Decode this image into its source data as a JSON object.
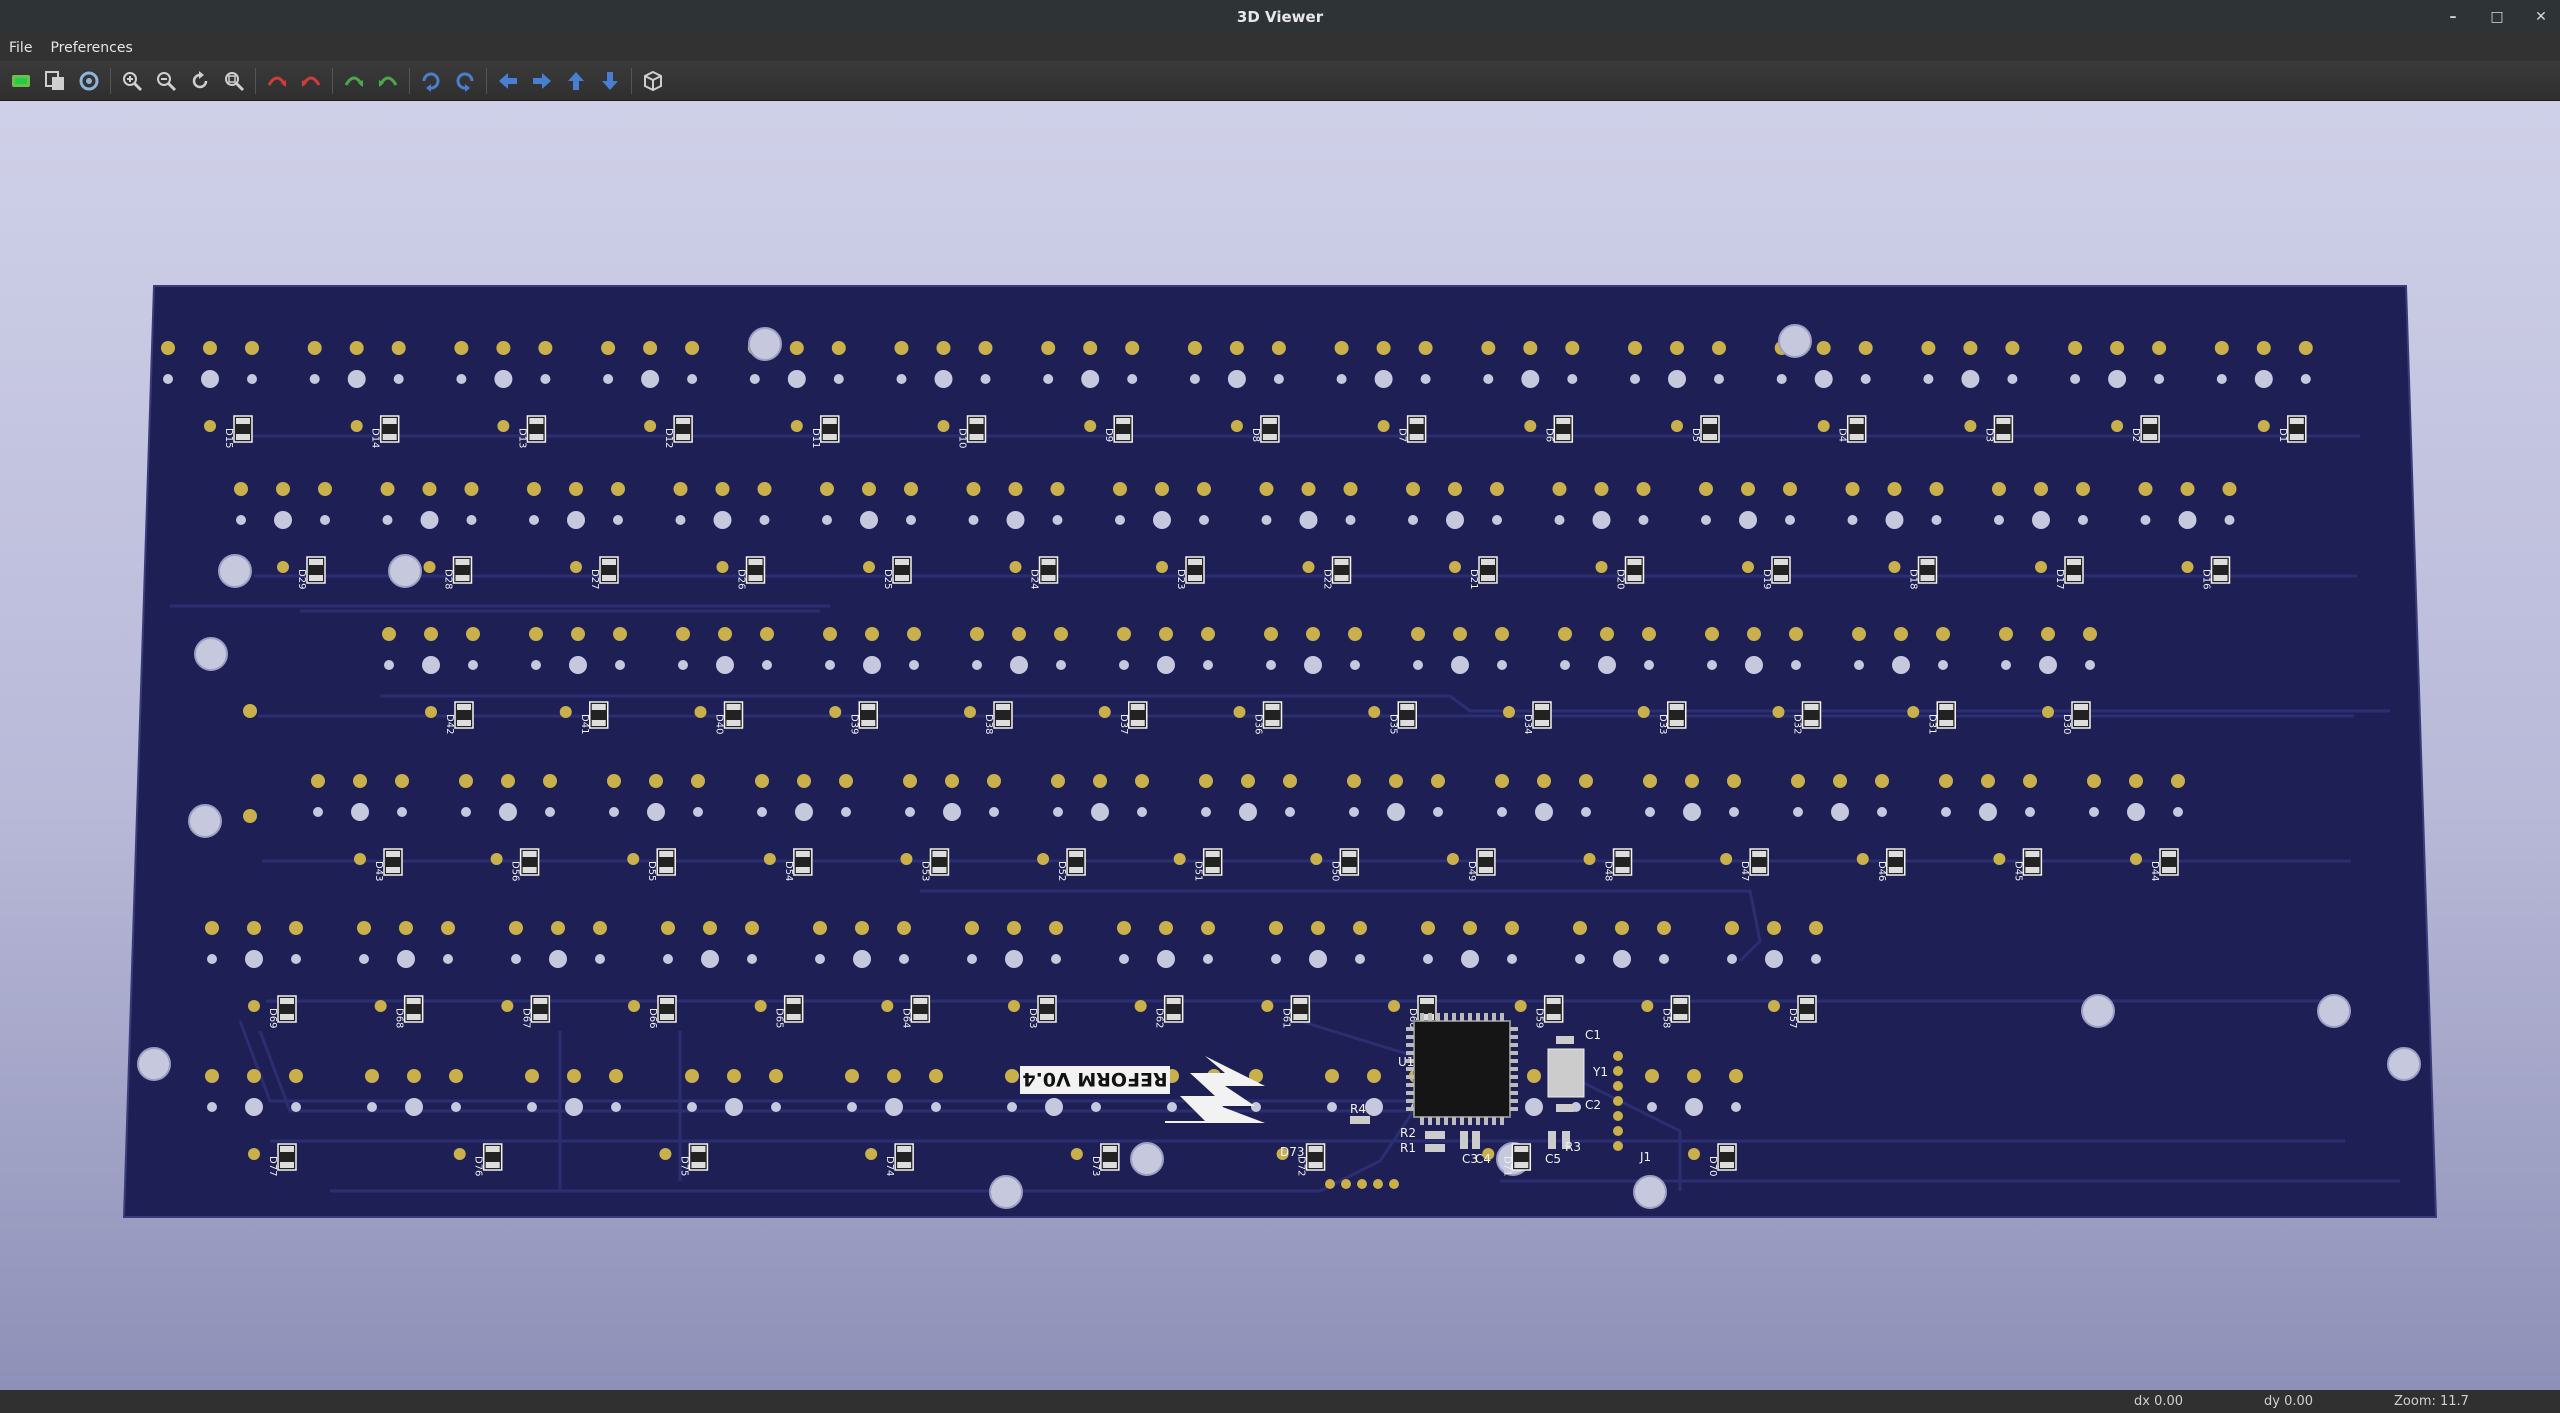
{
  "window": {
    "title": "3D Viewer",
    "minimize_icon": "minimize-icon",
    "maximize_icon": "maximize-icon",
    "close_icon": "close-icon"
  },
  "menu": {
    "file": "File",
    "preferences": "Preferences"
  },
  "toolbar": [
    {
      "icon": "reload-icon",
      "color": "#6cbf4a"
    },
    {
      "icon": "copy-icon",
      "color": "#cfcfcf"
    },
    {
      "icon": "settings-icon",
      "color": "#8fb4d9"
    },
    {
      "sep": true
    },
    {
      "icon": "zoom-in-icon",
      "color": "#d0d0d0"
    },
    {
      "icon": "zoom-out-icon",
      "color": "#d0d0d0"
    },
    {
      "icon": "zoom-redraw-icon",
      "color": "#d0d0d0"
    },
    {
      "icon": "zoom-fit-icon",
      "color": "#d0d0d0"
    },
    {
      "sep": true
    },
    {
      "icon": "rotate-x-icon",
      "color": "#d23b3b"
    },
    {
      "icon": "rotate-x-reverse-icon",
      "color": "#d23b3b"
    },
    {
      "sep": true
    },
    {
      "icon": "rotate-y-icon",
      "color": "#4ca64c"
    },
    {
      "icon": "rotate-y-reverse-icon",
      "color": "#4ca64c"
    },
    {
      "sep": true
    },
    {
      "icon": "rotate-z-icon",
      "color": "#4a7fd0"
    },
    {
      "icon": "rotate-z-reverse-icon",
      "color": "#4a7fd0"
    },
    {
      "sep": true
    },
    {
      "icon": "move-left-icon",
      "color": "#4a7fd0"
    },
    {
      "icon": "move-right-icon",
      "color": "#4a7fd0"
    },
    {
      "icon": "move-up-icon",
      "color": "#4a7fd0"
    },
    {
      "icon": "move-down-icon",
      "color": "#4a7fd0"
    },
    {
      "sep": true
    },
    {
      "icon": "ortho-view-icon",
      "color": "#cfcfcf"
    }
  ],
  "board": {
    "logo_text": "REFORM V0.4",
    "colors": {
      "pcb": "#1e1f55",
      "trace": "#2c2e72",
      "pad": "#c9b04a",
      "hole": "#c6c8de",
      "silk": "#f2f2f2"
    },
    "rows": [
      {
        "labels": [
          "D15",
          "D14",
          "D13",
          "D12",
          "D11",
          "D10",
          "D9",
          "D8",
          "D7",
          "D6",
          "D5",
          "D4",
          "D3",
          "D2",
          "D1"
        ]
      },
      {
        "labels": [
          "D29",
          "D28",
          "D27",
          "D26",
          "D25",
          "D24",
          "D23",
          "D22",
          "D21",
          "D20",
          "D19",
          "D18",
          "D17",
          "D16"
        ]
      },
      {
        "labels": [
          "D42",
          "D41",
          "D40",
          "D39",
          "D38",
          "D37",
          "D36",
          "D35",
          "D34",
          "D33",
          "D32",
          "D31",
          "D30"
        ]
      },
      {
        "labels": [
          "D43",
          "D56",
          "D55",
          "D54",
          "D53",
          "D52",
          "D51",
          "D50",
          "D49",
          "D48",
          "D47",
          "D46",
          "D45",
          "D44"
        ]
      },
      {
        "labels": [
          "D69",
          "D68",
          "D67",
          "D66",
          "D65",
          "D64",
          "D63",
          "D62",
          "D61",
          "D60",
          "D59",
          "D58",
          "D57"
        ]
      },
      {
        "labels": [
          "D77",
          "D76",
          "D75",
          "D74",
          "D73",
          "D72",
          "D71",
          "D70"
        ]
      }
    ],
    "components": [
      "U1",
      "C1",
      "Y1",
      "C2",
      "R4",
      "R2",
      "R1",
      "C5",
      "C4",
      "C3",
      "R3",
      "J1",
      "D73"
    ]
  },
  "status": {
    "dx": "dx 0.00",
    "dy": "dy 0.00",
    "zoom": "Zoom: 11.7"
  }
}
